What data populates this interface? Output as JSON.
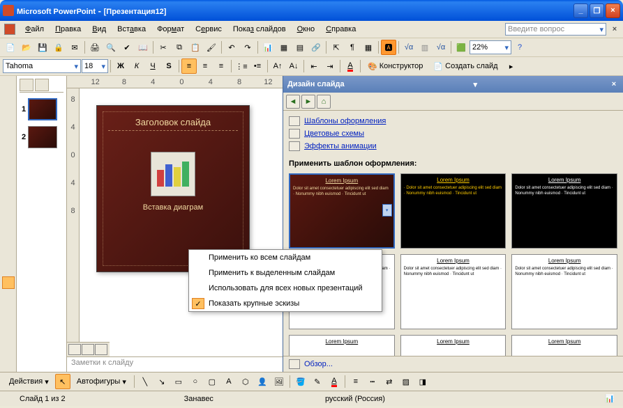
{
  "titlebar": {
    "app": "Microsoft PowerPoint",
    "doc": "[Презентация12]"
  },
  "menubar": {
    "items": [
      "Файл",
      "Правка",
      "Вид",
      "Вставка",
      "Формат",
      "Сервис",
      "Показ слайдов",
      "Окно",
      "Справка"
    ],
    "question_placeholder": "Введите вопрос"
  },
  "toolbar": {
    "font": "Tahoma",
    "size": "18",
    "zoom": "22%",
    "designer": "Конструктор",
    "new_slide": "Создать слайд"
  },
  "thumbnails": [
    {
      "num": "1",
      "selected": true
    },
    {
      "num": "2",
      "selected": false
    }
  ],
  "ruler_h": [
    "12",
    "8",
    "4",
    "0",
    "4",
    "8",
    "12"
  ],
  "ruler_v": [
    "8",
    "4",
    "0",
    "4",
    "8"
  ],
  "slide": {
    "title": "Заголовок слайда",
    "subtitle": "Вставка диаграм"
  },
  "notes_placeholder": "Заметки к слайду",
  "taskpane": {
    "title": "Дизайн слайда",
    "links": [
      "Шаблоны оформления",
      "Цветовые схемы",
      "Эффекты анимации"
    ],
    "section": "Применить шаблон оформления:",
    "templates": [
      {
        "title": "Lorem Ipsum",
        "class": "tp-t-dark",
        "selected": true,
        "body": "Dolor sit amet consectetuer adipiscing elit sed diam · Nonummy nibh euismod · Tincidunt ut"
      },
      {
        "title": "Lorem Ipsum",
        "class": "tp-t-black",
        "selected": false,
        "body": "· Dolor sit amet consectetuer adipiscing elit sed diam · Nonummy nibh euismod · Tincidunt ut"
      },
      {
        "title": "Lorem Ipsum",
        "class": "tp-t-fire",
        "selected": false,
        "body": "Dolor sit amet consectetuer adipiscing elit sed diam · Nonummy nibh euismod · Tincidunt ut"
      },
      {
        "title": "Lorem Ipsum",
        "class": "",
        "selected": false,
        "body": "Dolor sit amet consectetuer adipiscing elit sed diam · Nonummy nibh euismod"
      },
      {
        "title": "Lorem Ipsum",
        "class": "",
        "selected": false,
        "body": "Dolor sit amet consectetuer adipiscing elit sed diam · Nonummy nibh euismod · Tincidunt ut"
      },
      {
        "title": "Lorem Ipsum",
        "class": "",
        "selected": false,
        "body": "Dolor sit amet consectetuer adipiscing elit sed diam · Nonummy nibh euismod · Tincidunt ut"
      },
      {
        "title": "Lorem Ipsum",
        "class": "",
        "selected": false,
        "body": ""
      },
      {
        "title": "Lorem Ipsum",
        "class": "",
        "selected": false,
        "body": ""
      },
      {
        "title": "Lorem Ipsum",
        "class": "",
        "selected": false,
        "body": ""
      }
    ],
    "footer": "Обзор..."
  },
  "context_menu": {
    "items": [
      "Применить ко всем слайдам",
      "Применить к выделенным слайдам",
      "Использовать для всех новых презентаций",
      "Показать крупные эскизы"
    ],
    "checked_index": 3
  },
  "draw_toolbar": {
    "actions": "Действия",
    "autoshapes": "Автофигуры"
  },
  "statusbar": {
    "slide": "Слайд 1 из 2",
    "theme": "Занавес",
    "lang": "русский (Россия)"
  }
}
